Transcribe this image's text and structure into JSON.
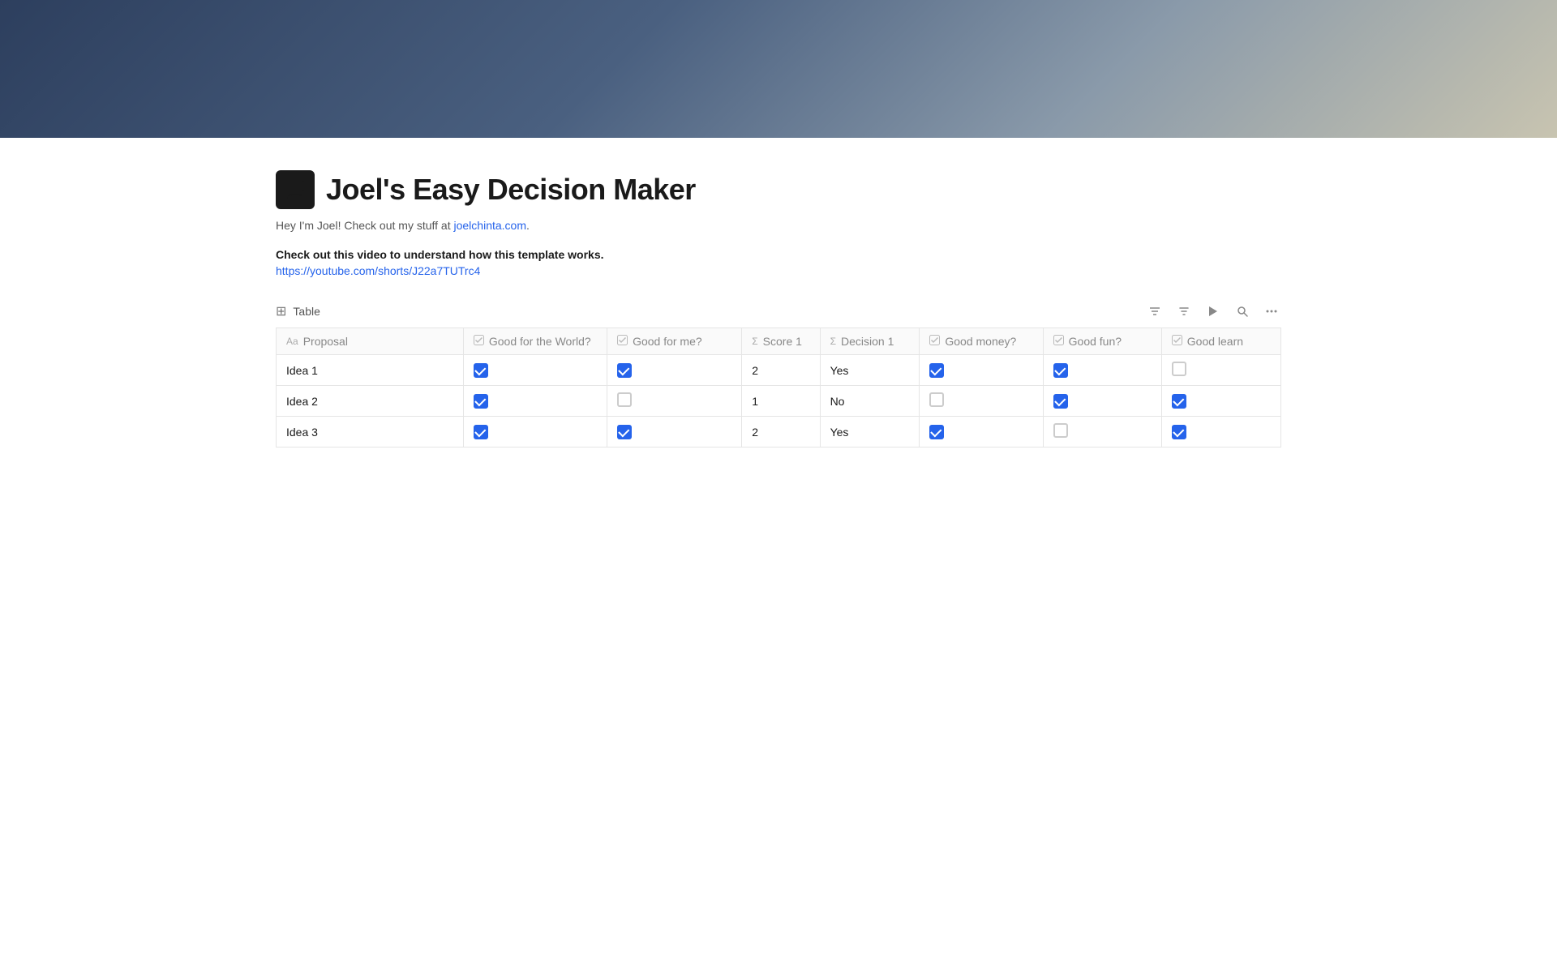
{
  "hero": {
    "gradient_description": "dark blue to tan gradient"
  },
  "page": {
    "icon": "🖥",
    "title": "Joel's Easy Decision Maker",
    "subtitle_text": "Hey I'm Joel! Check out my stuff at ",
    "subtitle_link_text": "joelchinta.com",
    "subtitle_link_url": "https://joelchinta.com",
    "subtitle_end": ".",
    "description": "Check out this video to understand how this template works.",
    "video_link": "https://youtube.com/shorts/J22a7TUTrc4"
  },
  "table": {
    "label": "Table",
    "columns": [
      {
        "id": "proposal",
        "icon": "Aa",
        "icon_type": "text",
        "label": "Proposal"
      },
      {
        "id": "world",
        "icon": "☑",
        "icon_type": "checkbox",
        "label": "Good for the World?"
      },
      {
        "id": "me",
        "icon": "☑",
        "icon_type": "checkbox",
        "label": "Good for me?"
      },
      {
        "id": "score",
        "icon": "Σ",
        "icon_type": "formula",
        "label": "Score 1"
      },
      {
        "id": "decision",
        "icon": "Σ",
        "icon_type": "formula",
        "label": "Decision 1"
      },
      {
        "id": "money",
        "icon": "☑",
        "icon_type": "checkbox",
        "label": "Good money?"
      },
      {
        "id": "fun",
        "icon": "☑",
        "icon_type": "checkbox",
        "label": "Good fun?"
      },
      {
        "id": "learn",
        "icon": "☑",
        "icon_type": "checkbox",
        "label": "Good learn"
      }
    ],
    "rows": [
      {
        "proposal": "Idea 1",
        "world": true,
        "me": true,
        "score": 2,
        "decision": "Yes",
        "money": true,
        "fun": true,
        "learn": false
      },
      {
        "proposal": "Idea 2",
        "world": true,
        "me": false,
        "score": 1,
        "decision": "No",
        "money": false,
        "fun": true,
        "learn": true
      },
      {
        "proposal": "Idea 3",
        "world": true,
        "me": true,
        "score": 2,
        "decision": "Yes",
        "money": true,
        "fun": false,
        "learn": true
      }
    ],
    "toolbar": {
      "filter_label": "Filter",
      "sort_label": "Sort",
      "automate_label": "Automate",
      "search_label": "Search",
      "more_label": "More"
    }
  }
}
